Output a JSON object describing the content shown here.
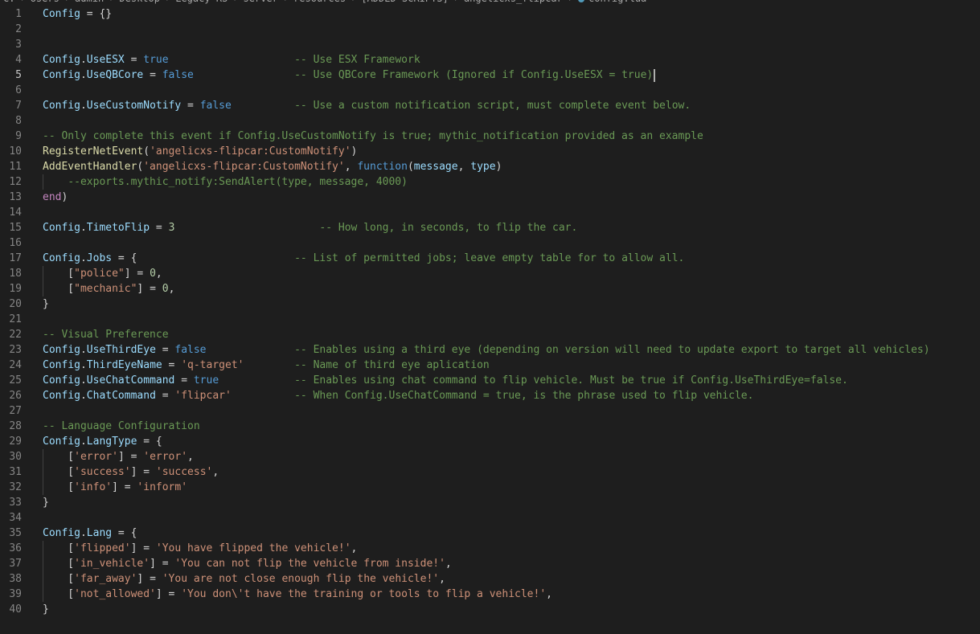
{
  "breadcrumb": {
    "parts": [
      "C:",
      "Users",
      "admin",
      "Desktop",
      "Legacy-RS",
      "server",
      "resources",
      "[ADDED SCRIPTS]",
      "angelicxs_flipcar",
      "config.lua"
    ]
  },
  "editor": {
    "active_line": 5,
    "lines": [
      {
        "n": "1",
        "tokens": [
          [
            "var",
            "Config"
          ],
          [
            "plain",
            " = {}"
          ]
        ]
      },
      {
        "n": "2",
        "tokens": []
      },
      {
        "n": "3",
        "tokens": []
      },
      {
        "n": "4",
        "tokens": [
          [
            "var",
            "Config"
          ],
          [
            "plain",
            "."
          ],
          [
            "var",
            "UseESX"
          ],
          [
            "plain",
            " = "
          ],
          [
            "kw",
            "true"
          ],
          [
            "plain",
            "                    "
          ],
          [
            "cm",
            "-- Use ESX Framework"
          ]
        ]
      },
      {
        "n": "5",
        "tokens": [
          [
            "var",
            "Config"
          ],
          [
            "plain",
            "."
          ],
          [
            "var",
            "UseQBCore"
          ],
          [
            "plain",
            " = "
          ],
          [
            "kw",
            "false"
          ],
          [
            "plain",
            "                "
          ],
          [
            "cm",
            "-- Use QBCore Framework (Ignored if Config.UseESX = true)"
          ]
        ]
      },
      {
        "n": "6",
        "tokens": []
      },
      {
        "n": "7",
        "tokens": [
          [
            "var",
            "Config"
          ],
          [
            "plain",
            "."
          ],
          [
            "var",
            "UseCustomNotify"
          ],
          [
            "plain",
            " = "
          ],
          [
            "kw",
            "false"
          ],
          [
            "plain",
            "          "
          ],
          [
            "cm",
            "-- Use a custom notification script, must complete event below."
          ]
        ]
      },
      {
        "n": "8",
        "tokens": []
      },
      {
        "n": "9",
        "tokens": [
          [
            "cm",
            "-- Only complete this event if Config.UseCustomNotify is true; mythic_notification provided as an example"
          ]
        ]
      },
      {
        "n": "10",
        "tokens": [
          [
            "fn",
            "RegisterNetEvent"
          ],
          [
            "plain",
            "("
          ],
          [
            "str",
            "'angelicxs-flipcar:CustomNotify'"
          ],
          [
            "plain",
            ")"
          ]
        ]
      },
      {
        "n": "11",
        "tokens": [
          [
            "fn",
            "AddEventHandler"
          ],
          [
            "plain",
            "("
          ],
          [
            "str",
            "'angelicxs-flipcar:CustomNotify'"
          ],
          [
            "plain",
            ", "
          ],
          [
            "kw",
            "function"
          ],
          [
            "plain",
            "("
          ],
          [
            "var",
            "message"
          ],
          [
            "plain",
            ", "
          ],
          [
            "var",
            "type"
          ],
          [
            "plain",
            ")"
          ]
        ]
      },
      {
        "n": "12",
        "tokens": [
          [
            "plain",
            "    "
          ],
          [
            "cm",
            "--exports.mythic_notify:SendAlert(type, message, 4000)"
          ]
        ],
        "guide": true
      },
      {
        "n": "13",
        "tokens": [
          [
            "ctl",
            "end"
          ],
          [
            "plain",
            ")"
          ]
        ]
      },
      {
        "n": "14",
        "tokens": []
      },
      {
        "n": "15",
        "tokens": [
          [
            "var",
            "Config"
          ],
          [
            "plain",
            "."
          ],
          [
            "var",
            "TimetoFlip"
          ],
          [
            "plain",
            " = "
          ],
          [
            "num",
            "3"
          ],
          [
            "plain",
            "                       "
          ],
          [
            "cm",
            "-- How long, in seconds, to flip the car."
          ]
        ]
      },
      {
        "n": "16",
        "tokens": []
      },
      {
        "n": "17",
        "tokens": [
          [
            "var",
            "Config"
          ],
          [
            "plain",
            "."
          ],
          [
            "var",
            "Jobs"
          ],
          [
            "plain",
            " = {                         "
          ],
          [
            "cm",
            "-- List of permitted jobs; leave empty table for to allow all."
          ]
        ]
      },
      {
        "n": "18",
        "tokens": [
          [
            "plain",
            "    ["
          ],
          [
            "str",
            "\"police\""
          ],
          [
            "plain",
            "] = "
          ],
          [
            "num",
            "0"
          ],
          [
            "plain",
            ","
          ]
        ],
        "guide": true
      },
      {
        "n": "19",
        "tokens": [
          [
            "plain",
            "    ["
          ],
          [
            "str",
            "\"mechanic\""
          ],
          [
            "plain",
            "] = "
          ],
          [
            "num",
            "0"
          ],
          [
            "plain",
            ","
          ]
        ],
        "guide": true
      },
      {
        "n": "20",
        "tokens": [
          [
            "plain",
            "}"
          ]
        ]
      },
      {
        "n": "21",
        "tokens": []
      },
      {
        "n": "22",
        "tokens": [
          [
            "cm",
            "-- Visual Preference"
          ]
        ]
      },
      {
        "n": "23",
        "tokens": [
          [
            "var",
            "Config"
          ],
          [
            "plain",
            "."
          ],
          [
            "var",
            "UseThirdEye"
          ],
          [
            "plain",
            " = "
          ],
          [
            "kw",
            "false"
          ],
          [
            "plain",
            "              "
          ],
          [
            "cm",
            "-- Enables using a third eye (depending on version will need to update export to target all vehicles)"
          ]
        ]
      },
      {
        "n": "24",
        "tokens": [
          [
            "var",
            "Config"
          ],
          [
            "plain",
            "."
          ],
          [
            "var",
            "ThirdEyeName"
          ],
          [
            "plain",
            " = "
          ],
          [
            "str",
            "'q-target'"
          ],
          [
            "plain",
            "        "
          ],
          [
            "cm",
            "-- Name of third eye aplication"
          ]
        ]
      },
      {
        "n": "25",
        "tokens": [
          [
            "var",
            "Config"
          ],
          [
            "plain",
            "."
          ],
          [
            "var",
            "UseChatCommand"
          ],
          [
            "plain",
            " = "
          ],
          [
            "kw",
            "true"
          ],
          [
            "plain",
            "            "
          ],
          [
            "cm",
            "-- Enables using chat command to flip vehicle. Must be true if Config.UseThirdEye=false."
          ]
        ]
      },
      {
        "n": "26",
        "tokens": [
          [
            "var",
            "Config"
          ],
          [
            "plain",
            "."
          ],
          [
            "var",
            "ChatCommand"
          ],
          [
            "plain",
            " = "
          ],
          [
            "str",
            "'flipcar'"
          ],
          [
            "plain",
            "          "
          ],
          [
            "cm",
            "-- When Config.UseChatCommand = true, is the phrase used to flip vehicle."
          ]
        ]
      },
      {
        "n": "27",
        "tokens": []
      },
      {
        "n": "28",
        "tokens": [
          [
            "cm",
            "-- Language Configuration"
          ]
        ]
      },
      {
        "n": "29",
        "tokens": [
          [
            "var",
            "Config"
          ],
          [
            "plain",
            "."
          ],
          [
            "var",
            "LangType"
          ],
          [
            "plain",
            " = {"
          ]
        ]
      },
      {
        "n": "30",
        "tokens": [
          [
            "plain",
            "    ["
          ],
          [
            "str",
            "'error'"
          ],
          [
            "plain",
            "] = "
          ],
          [
            "str",
            "'error'"
          ],
          [
            "plain",
            ","
          ]
        ],
        "guide": true
      },
      {
        "n": "31",
        "tokens": [
          [
            "plain",
            "    ["
          ],
          [
            "str",
            "'success'"
          ],
          [
            "plain",
            "] = "
          ],
          [
            "str",
            "'success'"
          ],
          [
            "plain",
            ","
          ]
        ],
        "guide": true
      },
      {
        "n": "32",
        "tokens": [
          [
            "plain",
            "    ["
          ],
          [
            "str",
            "'info'"
          ],
          [
            "plain",
            "] = "
          ],
          [
            "str",
            "'inform'"
          ]
        ],
        "guide": true
      },
      {
        "n": "33",
        "tokens": [
          [
            "plain",
            "}"
          ]
        ]
      },
      {
        "n": "34",
        "tokens": []
      },
      {
        "n": "35",
        "tokens": [
          [
            "var",
            "Config"
          ],
          [
            "plain",
            "."
          ],
          [
            "var",
            "Lang"
          ],
          [
            "plain",
            " = {"
          ]
        ]
      },
      {
        "n": "36",
        "tokens": [
          [
            "plain",
            "    ["
          ],
          [
            "str",
            "'flipped'"
          ],
          [
            "plain",
            "] = "
          ],
          [
            "str",
            "'You have flipped the vehicle!'"
          ],
          [
            "plain",
            ","
          ]
        ],
        "guide": true
      },
      {
        "n": "37",
        "tokens": [
          [
            "plain",
            "    ["
          ],
          [
            "str",
            "'in_vehicle'"
          ],
          [
            "plain",
            "] = "
          ],
          [
            "str",
            "'You can not flip the vehicle from inside!'"
          ],
          [
            "plain",
            ","
          ]
        ],
        "guide": true
      },
      {
        "n": "38",
        "tokens": [
          [
            "plain",
            "    ["
          ],
          [
            "str",
            "'far_away'"
          ],
          [
            "plain",
            "] = "
          ],
          [
            "str",
            "'You are not close enough flip the vehicle!'"
          ],
          [
            "plain",
            ","
          ]
        ],
        "guide": true
      },
      {
        "n": "39",
        "tokens": [
          [
            "plain",
            "    ["
          ],
          [
            "str",
            "'not_allowed'"
          ],
          [
            "plain",
            "] = "
          ],
          [
            "str",
            "'You don\\'t have the training or tools to flip a vehicle!'"
          ],
          [
            "plain",
            ","
          ]
        ],
        "guide": true
      },
      {
        "n": "40",
        "tokens": [
          [
            "plain",
            "}"
          ]
        ]
      }
    ]
  }
}
